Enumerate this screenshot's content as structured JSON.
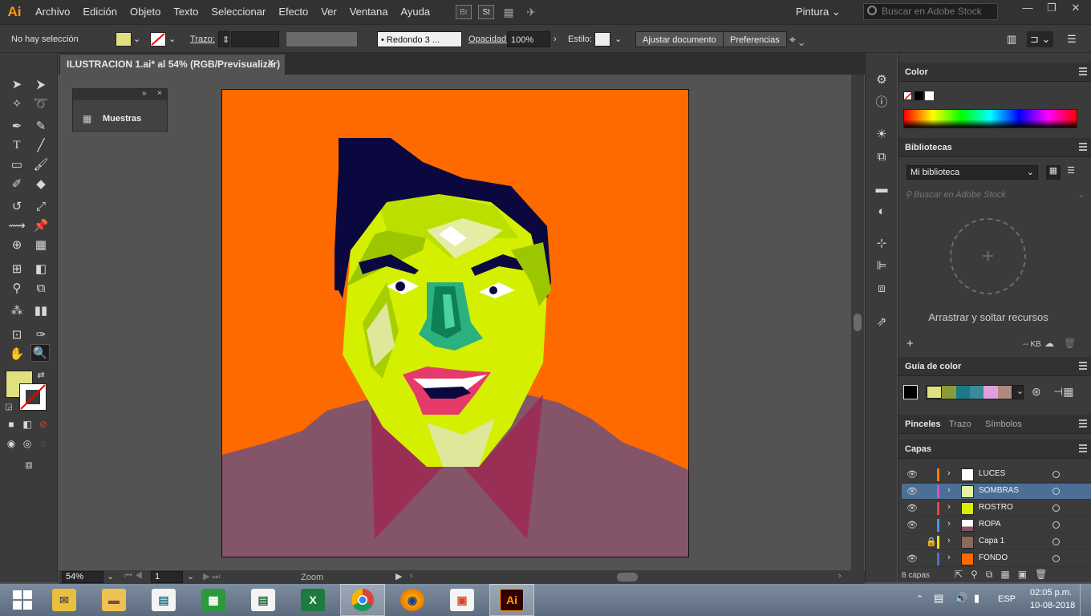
{
  "app": {
    "logo": "Ai"
  },
  "menu": [
    "Archivo",
    "Edición",
    "Objeto",
    "Texto",
    "Seleccionar",
    "Efecto",
    "Ver",
    "Ventana",
    "Ayuda"
  ],
  "menubar_icons": {
    "br": "Br",
    "st": "St"
  },
  "workspace": "Pintura",
  "stock_search_placeholder": "Buscar en Adobe Stock",
  "control": {
    "selection": "No hay selección",
    "stroke_label": "Trazo:",
    "brush": "Redondo 3 ...",
    "opacity_label": "Opacidad:",
    "opacity_value": "100%",
    "style_label": "Estilo:",
    "fit_button": "Ajustar documento",
    "prefs_button": "Preferencias"
  },
  "document": {
    "tab_title": "ILUSTRACION 1.ai* al 54% (RGB/Previsualizar)"
  },
  "muestras_panel": {
    "title": "Muestras"
  },
  "status": {
    "zoom_value": "54%",
    "artboard": "1",
    "mode": "Zoom"
  },
  "panels": {
    "color": {
      "title": "Color"
    },
    "libraries": {
      "title": "Bibliotecas",
      "library": "Mi biblioteca",
      "search_placeholder": "Buscar en Adobe Stock",
      "drop_hint": "Arrastrar y soltar recursos",
      "size": "-- KB"
    },
    "color_guide": {
      "title": "Guía de color"
    },
    "tabs": [
      "Pinceles",
      "Trazo",
      "Símbolos"
    ],
    "layers": {
      "title": "Capas",
      "rows": [
        {
          "name": "LUCES",
          "color": "#ff7a00"
        },
        {
          "name": "SOMBRAS",
          "color": "#e24bd6"
        },
        {
          "name": "ROSTRO",
          "color": "#e84646"
        },
        {
          "name": "ROPA",
          "color": "#4a90e8"
        },
        {
          "name": "Capa 1",
          "color": "#e8e020"
        },
        {
          "name": "FONDO",
          "color": "#4a70c8"
        }
      ],
      "count": "8 capas"
    }
  },
  "taskbar": {
    "language": "ESP",
    "time": "02:05 p.m.",
    "date": "10-08-2018"
  },
  "colors": {
    "artboard_bg": "#ff6a00",
    "fill_swatch": "#e0e080",
    "accent": "#ff9a00"
  }
}
